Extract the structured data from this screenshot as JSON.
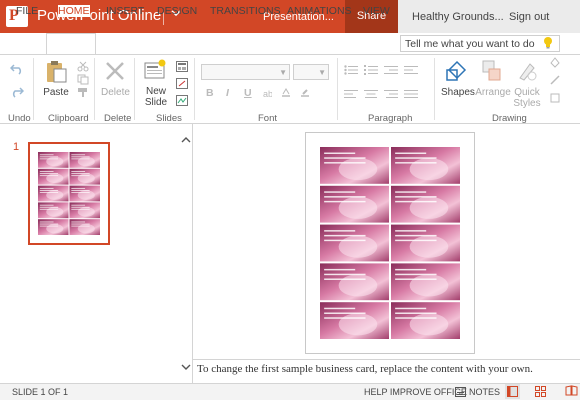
{
  "titlebar": {
    "app_title": "PowerPoint Online",
    "doc_name": "Presentation...",
    "share_label": "Share",
    "account_label": "Healthy Grounds...",
    "signout_label": "Sign out",
    "logo_letter": "P"
  },
  "tabs": [
    {
      "label": "FILE",
      "active": false
    },
    {
      "label": "HOME",
      "active": true
    },
    {
      "label": "INSERT",
      "active": false
    },
    {
      "label": "DESIGN",
      "active": false
    },
    {
      "label": "TRANSITIONS",
      "active": false
    },
    {
      "label": "ANIMATIONS",
      "active": false
    },
    {
      "label": "VIEW",
      "active": false
    }
  ],
  "tellme": {
    "placeholder": "Tell me what you want to do"
  },
  "ribbon": {
    "groups": {
      "undo": "Undo",
      "clipboard": "Clipboard",
      "delete": "Delete",
      "slides": "Slides",
      "font": "Font",
      "paragraph": "Paragraph",
      "drawing": "Drawing"
    },
    "buttons": {
      "paste": "Paste",
      "delete": "Delete",
      "new_slide_1": "New",
      "new_slide_2": "Slide",
      "shapes": "Shapes",
      "arrange": "Arrange",
      "quick_styles_1": "Quick",
      "quick_styles_2": "Styles"
    },
    "format": {
      "bold": "B",
      "italic": "I",
      "underline": "U"
    }
  },
  "slides_pane": {
    "slide_number": "1"
  },
  "notes": {
    "text": "To change the first sample business card, replace the content with your own."
  },
  "status": {
    "slide_info": "SLIDE 1 OF 1",
    "help_improve": "HELP IMPROVE OFFICE",
    "notes_label": "NOTES"
  },
  "colors": {
    "accent": "#d24726",
    "share_bg": "#a33619",
    "card_pink": "#c04a7a"
  },
  "icons": [
    "undo-icon",
    "redo-icon",
    "paste-icon",
    "cut-icon",
    "copy-icon",
    "format-painter-icon",
    "delete-icon",
    "new-slide-icon",
    "layout-icon",
    "reset-icon",
    "duplicate-icon",
    "bullets-icon",
    "numbering-icon",
    "shapes-icon",
    "arrange-icon",
    "quick-styles-icon",
    "lightbulb-icon",
    "chevron-down-icon",
    "chevron-up-icon"
  ]
}
